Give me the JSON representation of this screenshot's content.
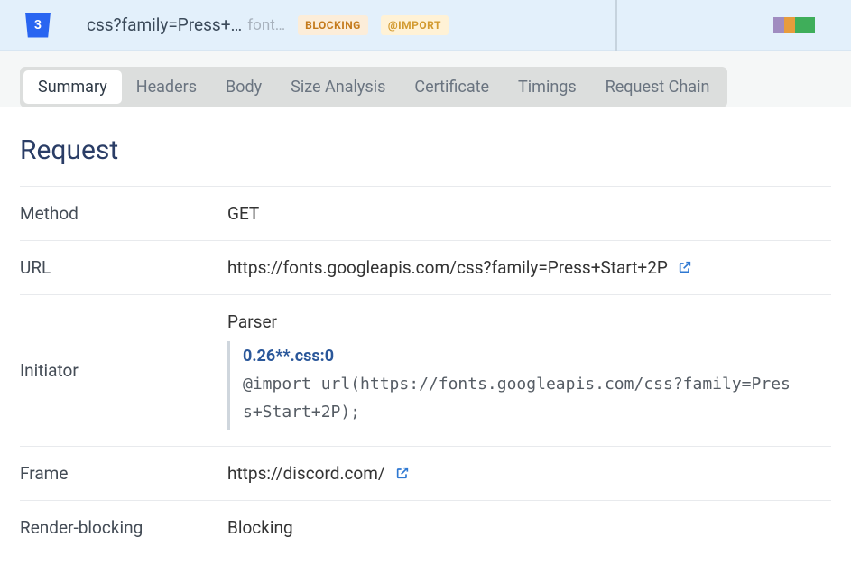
{
  "header": {
    "icon_letter": "3",
    "file_name": "css?family=Press+…",
    "domain_hint": "font…",
    "badges": {
      "blocking": "BLOCKING",
      "import": "@IMPORT"
    }
  },
  "tabs": [
    {
      "label": "Summary",
      "active": true
    },
    {
      "label": "Headers"
    },
    {
      "label": "Body"
    },
    {
      "label": "Size Analysis"
    },
    {
      "label": "Certificate"
    },
    {
      "label": "Timings"
    },
    {
      "label": "Request Chain"
    }
  ],
  "section": {
    "title": "Request"
  },
  "request": {
    "method": {
      "key": "Method",
      "value": "GET"
    },
    "url": {
      "key": "URL",
      "value": "https://fonts.googleapis.com/css?family=Press+Start+2P"
    },
    "initiator": {
      "key": "Initiator",
      "parser_label": "Parser",
      "source_link": "0.26**.css:0",
      "code": "@import url(https://fonts.googleapis.com/css?family=Press+Start+2P);"
    },
    "frame": {
      "key": "Frame",
      "value": "https://discord.com/"
    },
    "render_blocking": {
      "key": "Render-blocking",
      "value": "Blocking"
    }
  }
}
